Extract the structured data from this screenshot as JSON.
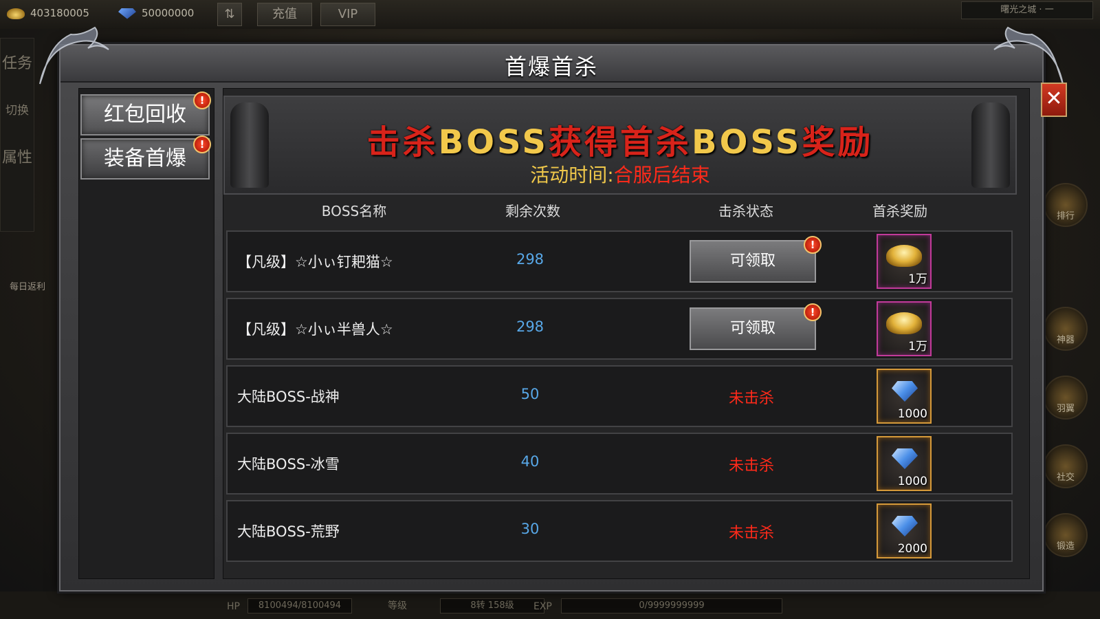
{
  "hud": {
    "gold": "403180005",
    "diamonds": "50000000",
    "recharge": "充值",
    "vip": "VIP",
    "zone": "曙光之城 · 一",
    "left_menu": [
      "任务",
      "切换",
      "属性"
    ],
    "daily_rebate": "每日返利",
    "right_menu": [
      "排行",
      "神器",
      "羽翼",
      "社交",
      "锻造"
    ],
    "hp_label": "HP",
    "hp_value": "8100494/8100494",
    "level_label": "等级",
    "level_value": "8转 158级",
    "exp_label": "EXP",
    "exp_value": "0/9999999999"
  },
  "panel": {
    "title": "首爆首杀",
    "close": "✕"
  },
  "tabs": [
    {
      "label": "红包回收",
      "badge": "!"
    },
    {
      "label": "装备首爆",
      "badge": "!"
    }
  ],
  "banner": {
    "headline": [
      {
        "text": "击杀",
        "color": "red"
      },
      {
        "text": "BOSS",
        "color": "gold"
      },
      {
        "text": "获得首杀",
        "color": "red"
      },
      {
        "text": "BOSS",
        "color": "gold"
      },
      {
        "text": "奖励",
        "color": "red"
      }
    ],
    "time_label": "活动时间:",
    "time_value": "合服后结束"
  },
  "table": {
    "headers": [
      "BOSS名称",
      "剩余次数",
      "击杀状态",
      "首杀奖励"
    ],
    "rows": [
      {
        "name": "【凡级】☆小ぃ钉耙猫☆",
        "count": "298",
        "status": "可领取",
        "claimable": true,
        "reward_type": "yuanbao",
        "reward_amount": "1万"
      },
      {
        "name": "【凡级】☆小ぃ半兽人☆",
        "count": "298",
        "status": "可领取",
        "claimable": true,
        "reward_type": "yuanbao",
        "reward_amount": "1万"
      },
      {
        "name": "大陆BOSS-战神",
        "count": "50",
        "status": "未击杀",
        "claimable": false,
        "reward_type": "diamond",
        "reward_amount": "1000"
      },
      {
        "name": "大陆BOSS-冰雪",
        "count": "40",
        "status": "未击杀",
        "claimable": false,
        "reward_type": "diamond",
        "reward_amount": "1000"
      },
      {
        "name": "大陆BOSS-荒野",
        "count": "30",
        "status": "未击杀",
        "claimable": false,
        "reward_type": "diamond",
        "reward_amount": "2000"
      }
    ]
  },
  "colors": {
    "accent_red": "#d8231a",
    "accent_gold": "#f2c84b",
    "count_blue": "#58a8e8"
  }
}
